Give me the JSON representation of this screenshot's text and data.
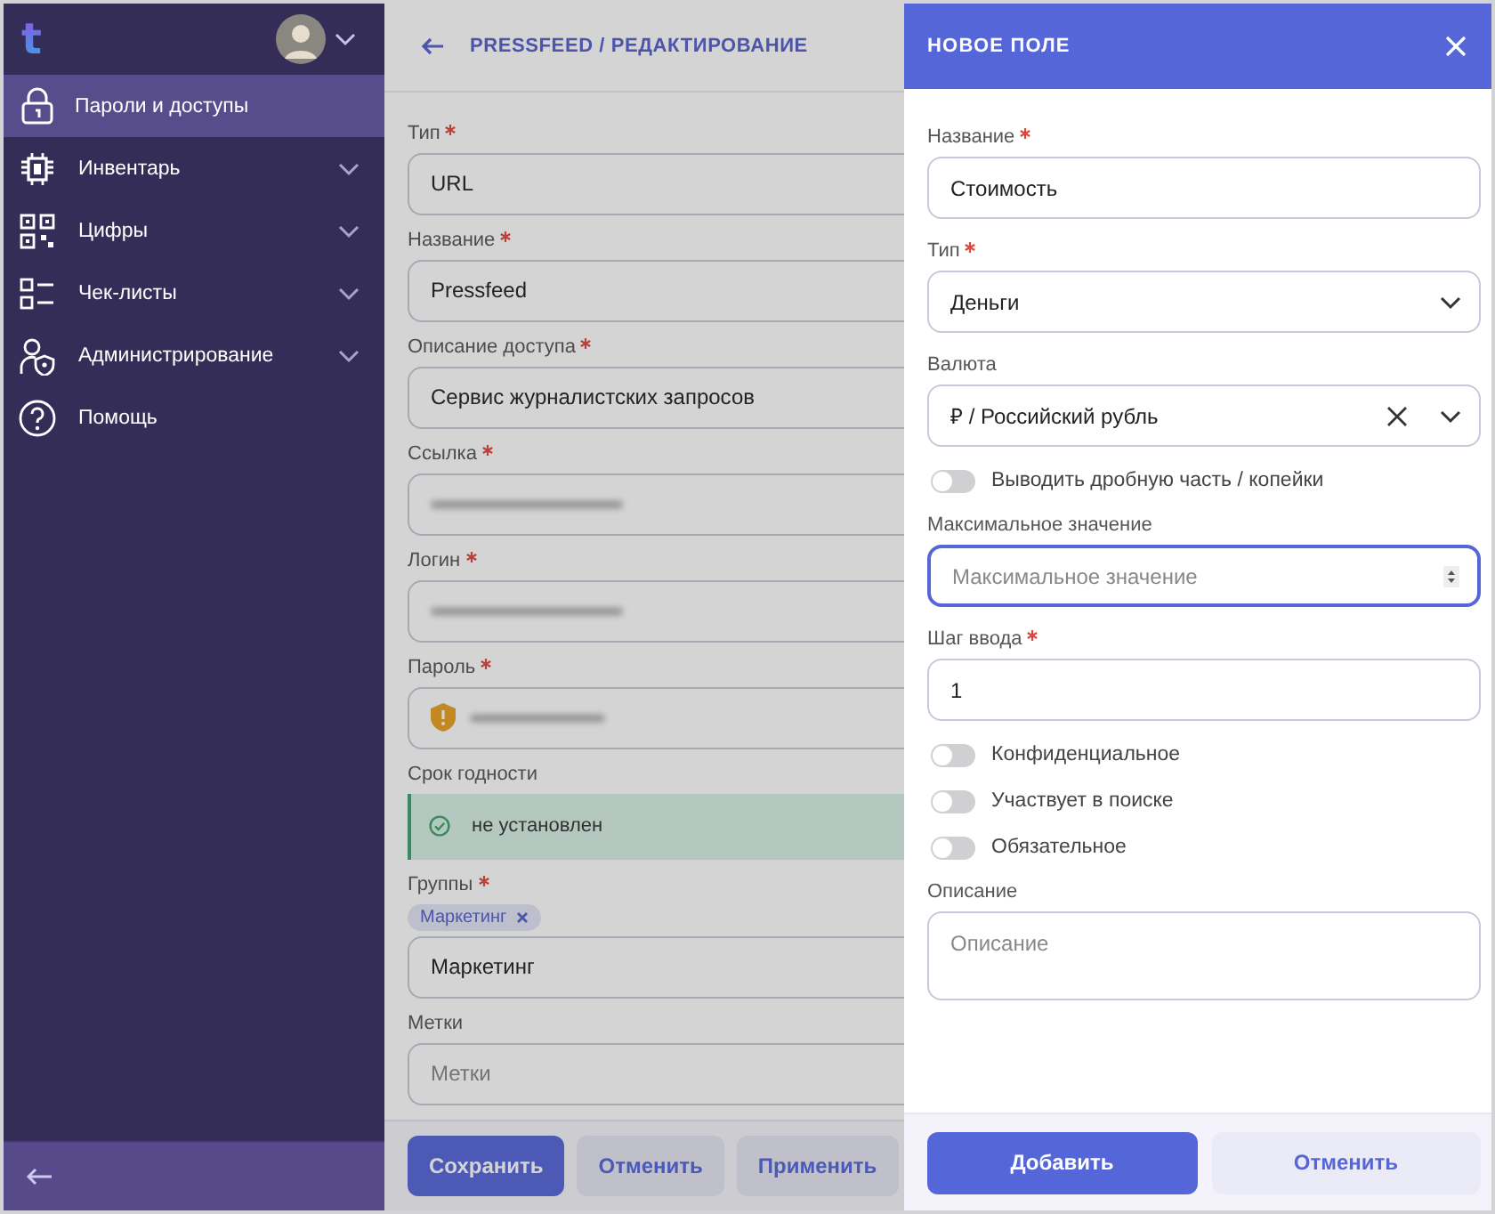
{
  "sidebar": {
    "logo": "t",
    "items": [
      {
        "label": "Пароли и доступы",
        "selected": true,
        "expandable": false
      },
      {
        "label": "Инвентарь",
        "selected": false,
        "expandable": true
      },
      {
        "label": "Цифры",
        "selected": false,
        "expandable": true
      },
      {
        "label": "Чек-листы",
        "selected": false,
        "expandable": true
      },
      {
        "label": "Администрирование",
        "selected": false,
        "expandable": true
      },
      {
        "label": "Помощь",
        "selected": false,
        "expandable": false
      }
    ]
  },
  "editor": {
    "title": "PRESSFEED / РЕДАКТИРОВАНИЕ",
    "fields": [
      {
        "label": "Тип",
        "required": true,
        "kind": "text",
        "value": "URL"
      },
      {
        "label": "Название",
        "required": true,
        "kind": "text",
        "value": "Pressfeed"
      },
      {
        "label": "Описание доступа",
        "required": true,
        "kind": "text",
        "value": "Сервис журналистских запросов"
      },
      {
        "label": "Ссылка",
        "required": true,
        "kind": "redacted"
      },
      {
        "label": "Логин",
        "required": true,
        "kind": "redacted"
      },
      {
        "label": "Пароль",
        "required": true,
        "kind": "password"
      },
      {
        "label": "Срок годности",
        "required": false,
        "kind": "status",
        "value": "не установлен"
      },
      {
        "label": "Группы",
        "required": true,
        "kind": "tags",
        "tags": [
          "Маркетинг"
        ],
        "value": "Маркетинг"
      },
      {
        "label": "Метки",
        "required": false,
        "kind": "placeholder",
        "placeholder": "Метки"
      }
    ],
    "buttons": [
      {
        "label": "Сохранить",
        "kind": "primary"
      },
      {
        "label": "Отменить",
        "kind": "secondary"
      },
      {
        "label": "Применить",
        "kind": "secondary"
      }
    ]
  },
  "panel": {
    "title": "НОВОЕ ПОЛЕ",
    "items": [
      {
        "kind": "text",
        "label": "Название",
        "required": true,
        "value": "Стоимость"
      },
      {
        "kind": "select",
        "label": "Тип",
        "required": true,
        "value": "Деньги",
        "clearable": false
      },
      {
        "kind": "select",
        "label": "Валюта",
        "required": false,
        "value": "₽ / Российский рубль",
        "clearable": true
      },
      {
        "kind": "toggle",
        "label": "Выводить дробную часть / копейки",
        "on": false
      },
      {
        "kind": "number",
        "label": "Максимальное значение",
        "required": false,
        "placeholder": "Максимальное значение",
        "focused": true
      },
      {
        "kind": "text",
        "label": "Шаг ввода",
        "required": true,
        "value": "1"
      },
      {
        "kind": "toggle",
        "label": "Конфиденциальное",
        "on": false
      },
      {
        "kind": "toggle",
        "label": "Участвует в поиске",
        "on": false
      },
      {
        "kind": "toggle",
        "label": "Обязательное",
        "on": false
      },
      {
        "kind": "textarea",
        "label": "Описание",
        "required": false,
        "placeholder": "Описание"
      }
    ],
    "buttons": [
      {
        "label": "Добавить",
        "kind": "primary"
      },
      {
        "label": "Отменить",
        "kind": "secondary"
      }
    ]
  }
}
